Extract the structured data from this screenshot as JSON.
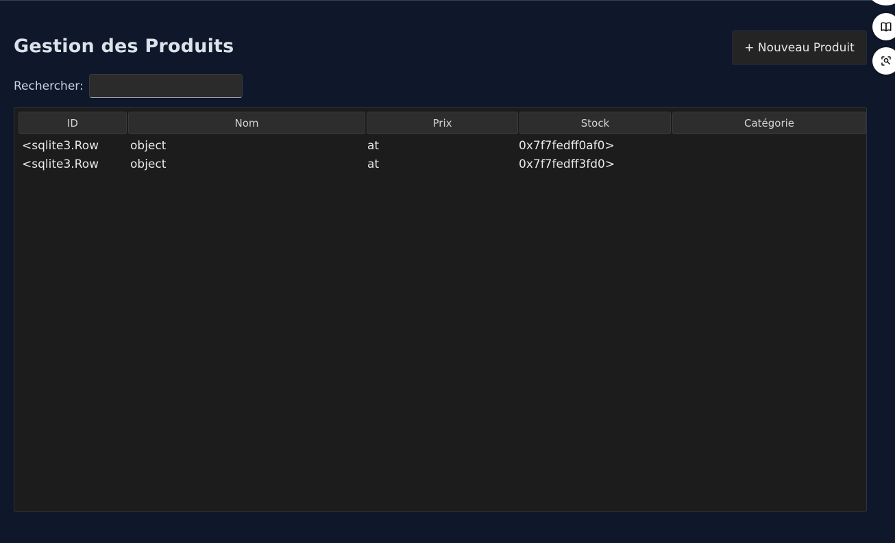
{
  "header": {
    "title": "Gestion des Produits",
    "new_button_label": "+ Nouveau Produit"
  },
  "search": {
    "label": "Rechercher:",
    "value": "",
    "placeholder": ""
  },
  "table": {
    "columns": [
      "ID",
      "Nom",
      "Prix",
      "Stock",
      "Catégorie"
    ],
    "rows": [
      [
        "<sqlite3.Row",
        "object",
        "at",
        "0x7f7fedff0af0>",
        ""
      ],
      [
        "<sqlite3.Row",
        "object",
        "at",
        "0x7f7fedff3fd0>",
        ""
      ]
    ]
  },
  "side_toolbar": {
    "icons": [
      "circle-button-partial",
      "book-icon",
      "image-search-icon"
    ]
  },
  "colors": {
    "background": "#0f172a",
    "panel": "#1c1c1c",
    "button": "#242424",
    "header_cell": "#2d2d2d",
    "text": "#e5e7eb"
  }
}
